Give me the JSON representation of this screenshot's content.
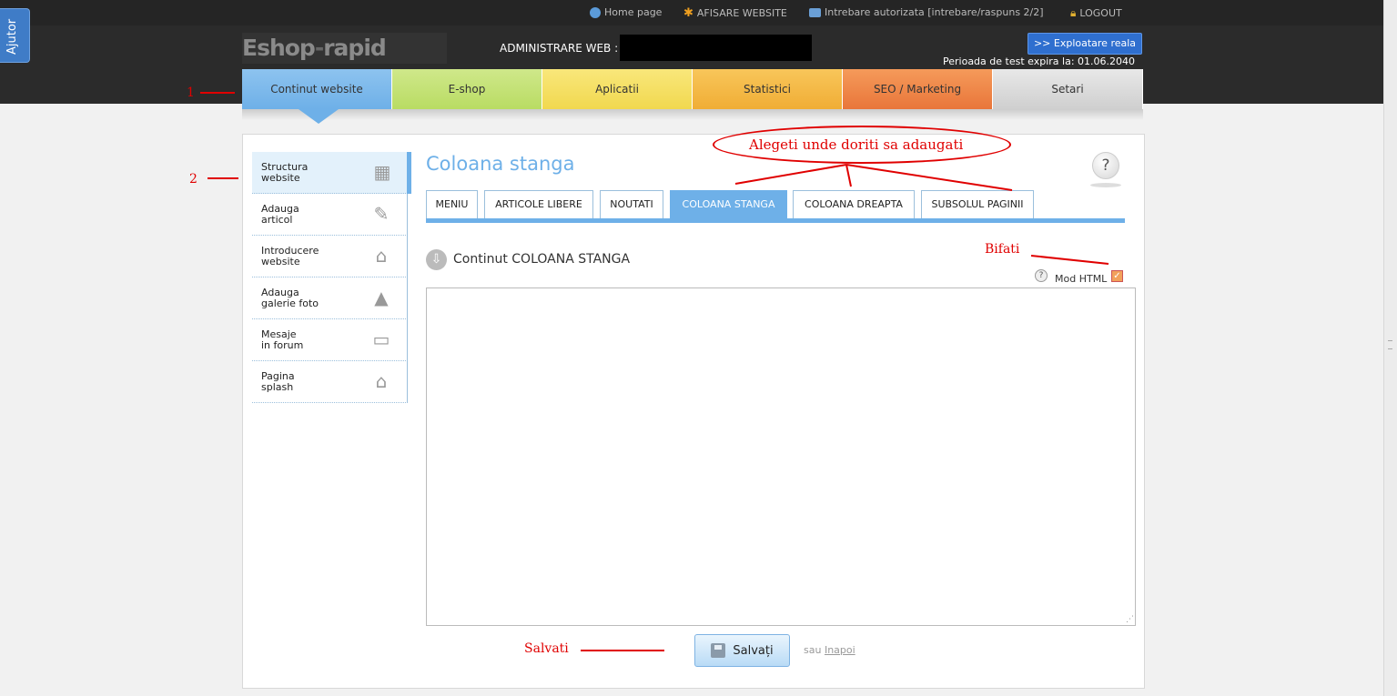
{
  "help_tab": "Ajutor",
  "top_links": {
    "home": "Home page",
    "afisare": "AFISARE WEBSITE",
    "intrebare": "Intrebare autorizata [intrebare/raspuns 2/2]",
    "logout": "LOGOUT"
  },
  "header": {
    "logo_part1": "Eshop",
    "logo_dash": "-",
    "logo_part2": "rapid",
    "admin_label": "ADMINISTRARE WEB :",
    "exploit_button": ">> Exploatare reala",
    "trial_text": "Perioada de test expira la: 01.06.2040"
  },
  "nav": {
    "continut": "Continut website",
    "eshop": "E-shop",
    "aplicatii": "Aplicatii",
    "statistici": "Statistici",
    "seo": "SEO / Marketing",
    "setari": "Setari"
  },
  "sidebar": {
    "items": [
      {
        "line1": "Structura",
        "line2": "website"
      },
      {
        "line1": "Adauga",
        "line2": "articol"
      },
      {
        "line1": "Introducere",
        "line2": "website"
      },
      {
        "line1": "Adauga",
        "line2": "galerie foto"
      },
      {
        "line1": "Mesaje",
        "line2": "in forum"
      },
      {
        "line1": "Pagina",
        "line2": "splash"
      }
    ]
  },
  "main": {
    "title": "Coloana stanga",
    "help": "?",
    "subtabs": [
      "MENIU",
      "ARTICOLE LIBERE",
      "NOUTATI",
      "COLOANA STANGA",
      "COLOANA DREAPTA",
      "SUBSOLUL PAGINII"
    ],
    "content_heading": "Continut COLOANA STANGA",
    "mod_html_label": "Mod HTML",
    "mod_html_help": "?",
    "editor_value": "",
    "save_button": "Salvați",
    "sau": "sau",
    "inapoi": "Inapoi"
  },
  "annotations": {
    "one": "1",
    "two": "2",
    "alegeti": "Alegeti unde doriti sa adaugati",
    "bifati": "Bifati",
    "salvati": "Salvati"
  },
  "colors": {
    "accent": "#6eb0e8",
    "annotation": "#e00000"
  }
}
